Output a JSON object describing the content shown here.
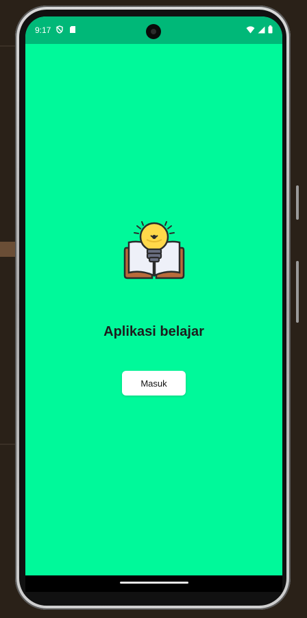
{
  "status_bar": {
    "time": "9:17",
    "left_icons": [
      "shield-icon",
      "sim-card-icon"
    ],
    "right_icons": [
      "wifi-icon",
      "signal-icon",
      "battery-icon"
    ],
    "color": "#00b878"
  },
  "app": {
    "background_color": "#00f99a",
    "logo": "lightbulb-book-icon",
    "title": "Aplikasi belajar",
    "button_label": "Masuk"
  },
  "nav_bar": {
    "home_indicator": "home-indicator"
  }
}
